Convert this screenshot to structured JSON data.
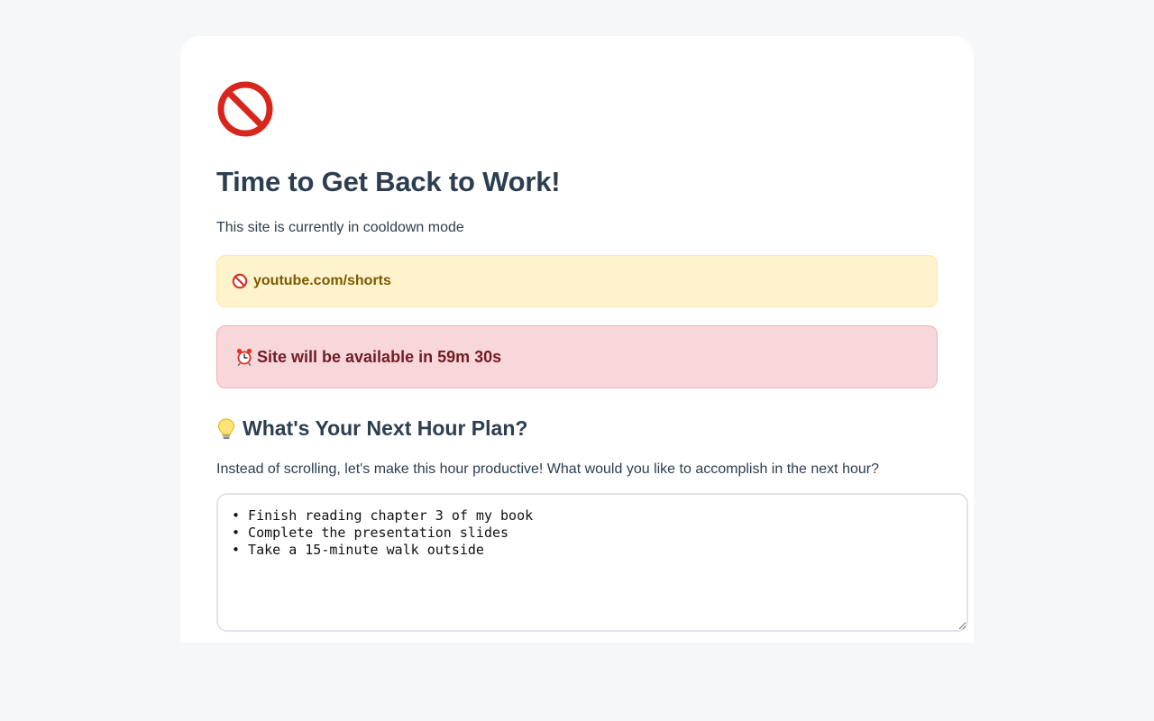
{
  "header": {
    "hero_icon": "prohibited-icon",
    "title": "Time to Get Back to Work!",
    "subtitle": "This site is currently in cooldown mode"
  },
  "blocked_site": {
    "icon": "prohibited-icon",
    "url": "youtube.com/shorts"
  },
  "cooldown": {
    "icon": "alarm-clock-icon",
    "message": "Site will be available in 59m 30s"
  },
  "plan": {
    "icon": "lightbulb-icon",
    "heading": "What's Your Next Hour Plan?",
    "description": "Instead of scrolling, let's make this hour productive! What would you like to accomplish in the next hour?",
    "value": "• Finish reading chapter 3 of my book\n• Complete the presentation slides\n• Take a 15-minute walk outside"
  },
  "colors": {
    "page_background": "#f6f7f9",
    "card_background": "#ffffff",
    "text_primary": "#2c3e50",
    "warning_background": "#fff3cd",
    "warning_text": "#7a5b00",
    "danger_background": "#f8d7da",
    "danger_text": "#721c24"
  }
}
